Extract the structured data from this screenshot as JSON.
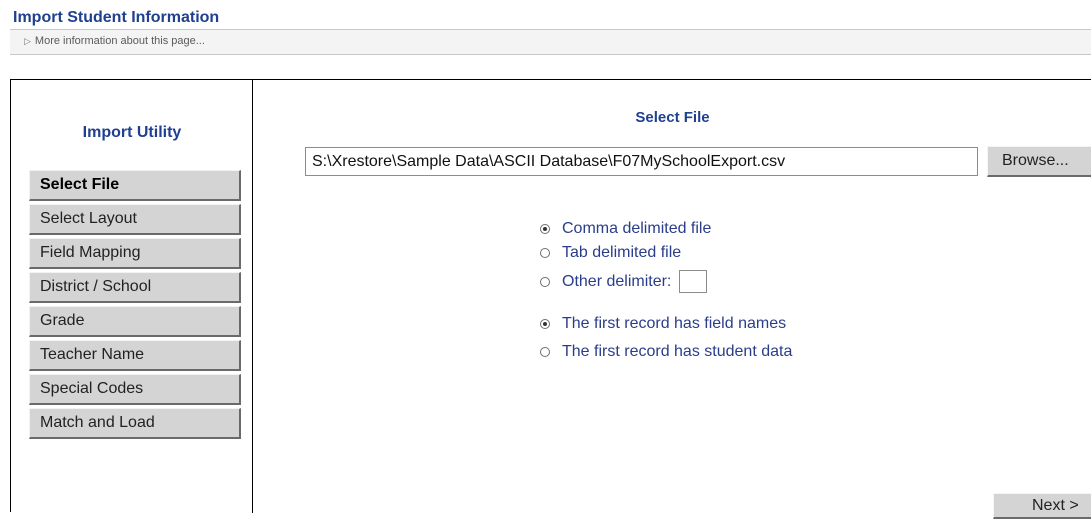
{
  "page": {
    "title": "Import Student Information",
    "more_info": "More information about this page..."
  },
  "sidebar": {
    "title": "Import Utility",
    "items": [
      {
        "label": "Select File",
        "active": true
      },
      {
        "label": "Select Layout",
        "active": false
      },
      {
        "label": "Field Mapping",
        "active": false
      },
      {
        "label": "District / School",
        "active": false
      },
      {
        "label": "Grade",
        "active": false
      },
      {
        "label": "Teacher Name",
        "active": false
      },
      {
        "label": "Special Codes",
        "active": false
      },
      {
        "label": "Match and Load",
        "active": false
      }
    ]
  },
  "main": {
    "section_title": "Select File",
    "file_path": "S:\\Xrestore\\Sample Data\\ASCII Database\\F07MySchoolExport.csv",
    "browse_label": "Browse...",
    "delimiter_options": [
      {
        "label": "Comma delimited file",
        "selected": true
      },
      {
        "label": "Tab delimited file",
        "selected": false
      },
      {
        "label": "Other delimiter:",
        "selected": false
      }
    ],
    "other_delimiter_value": "",
    "record_options": [
      {
        "label": "The first record has field names",
        "selected": true
      },
      {
        "label": "The first record has student data",
        "selected": false
      }
    ],
    "next_label": "Next >"
  },
  "colors": {
    "title_blue": "#1f3f8f",
    "option_text": "#2a3d8a",
    "button_face": "#d4d4d4"
  }
}
